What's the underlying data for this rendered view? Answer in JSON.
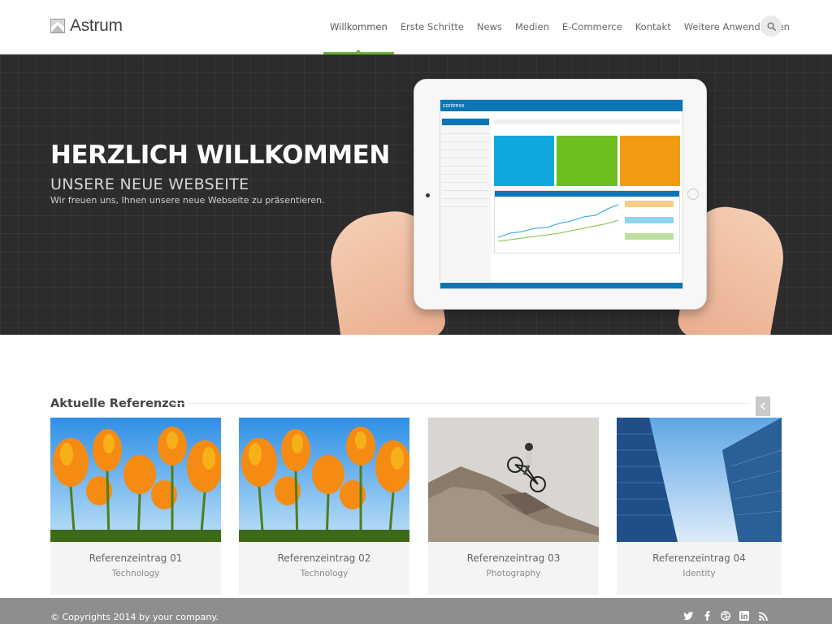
{
  "brand": {
    "name": "Astrum"
  },
  "nav": {
    "items": [
      {
        "label": "Willkommen"
      },
      {
        "label": "Erste Schritte"
      },
      {
        "label": "News"
      },
      {
        "label": "Medien"
      },
      {
        "label": "E-Commerce"
      },
      {
        "label": "Kontakt"
      },
      {
        "label": "Weitere Anwendungen"
      }
    ],
    "active_index": 0,
    "search_icon": "search-icon"
  },
  "hero": {
    "title": "HERZLICH WILLKOMMEN",
    "subtitle": "UNSERE NEUE WEBSEITE",
    "text": "Wir freuen uns, Ihnen unsere neue Webseite zu präsentieren.",
    "tablet_brand": "contrexx"
  },
  "references": {
    "title": "Aktuelle Referenzen",
    "items": [
      {
        "title": "Referenzeintrag 01",
        "category": "Technology"
      },
      {
        "title": "Referenzeintrag 02",
        "category": "Technology"
      },
      {
        "title": "Referenzeintrag 03",
        "category": "Photography"
      },
      {
        "title": "Referenzeintrag 04",
        "category": "Identity"
      }
    ]
  },
  "footer": {
    "copyright": "© Copyrights 2014 by your company.",
    "socials": [
      "twitter-icon",
      "facebook-icon",
      "dribbble-icon",
      "linkedin-icon",
      "rss-icon"
    ]
  },
  "colors": {
    "accent": "#6bb23a",
    "hero_bg": "#2c2c2c",
    "footer_bg": "#8e8e8e",
    "tile_blue": "#0fa8de",
    "tile_green": "#6cbf1f",
    "tile_orange": "#f29a14"
  }
}
